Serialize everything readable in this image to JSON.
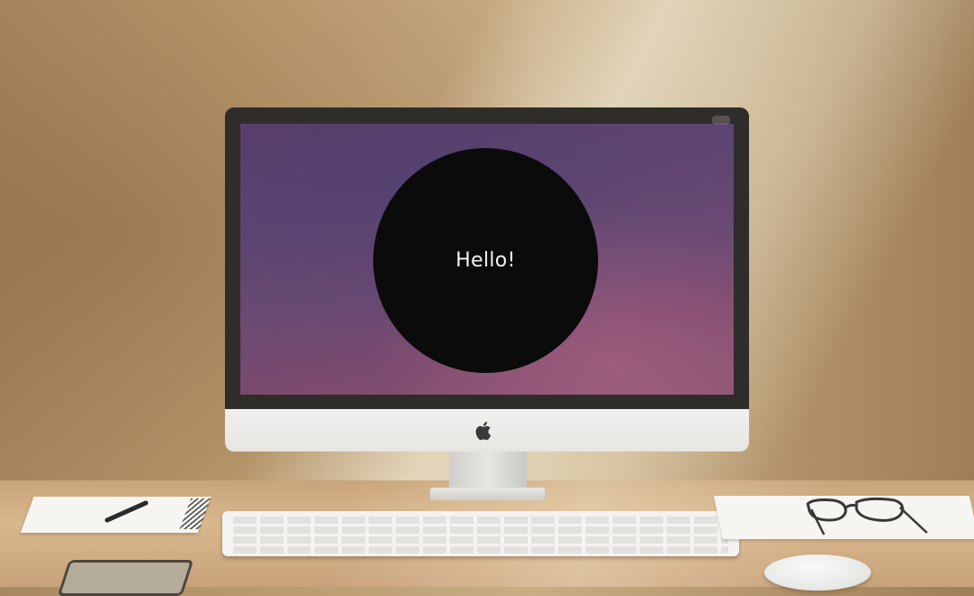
{
  "screen": {
    "greeting": "Hello!"
  },
  "icons": {
    "monitor_logo": "apple-logo-icon"
  },
  "colors": {
    "circle": "#0b0b0b",
    "greeting_text": "#f2f2f2",
    "screen_bg": "#5e4571"
  }
}
